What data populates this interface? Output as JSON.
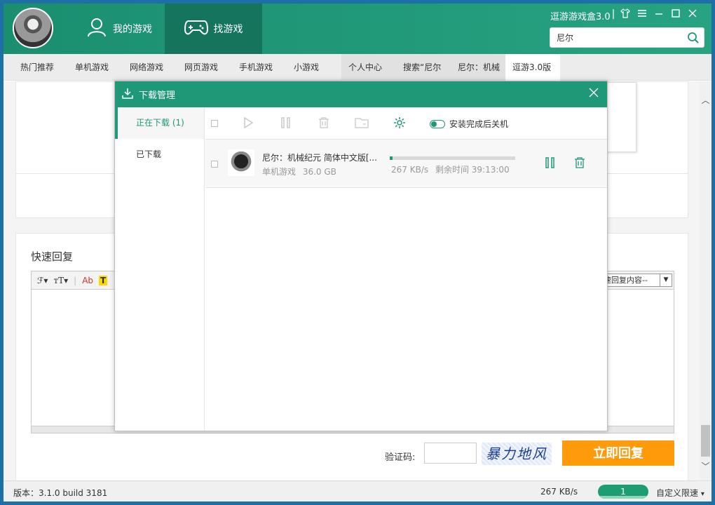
{
  "header": {
    "tabs": [
      {
        "label": "我的游戏",
        "icon": "user-icon"
      },
      {
        "label": "找游戏",
        "icon": "gamepad-icon"
      }
    ],
    "brand": "逗游游戏盒3.0",
    "window_controls": [
      "shirt-icon",
      "menu-icon",
      "minimize-icon",
      "maximize-icon",
      "close-icon"
    ],
    "search": {
      "value": "尼尔",
      "icon": "search-icon"
    }
  },
  "categories": [
    "热门推荐",
    "单机游戏",
    "网络游戏",
    "网页游戏",
    "手机游戏",
    "小游戏",
    "个人中心",
    "搜索“尼尔",
    "尼尔：机械",
    "逗游3.0版"
  ],
  "reply": {
    "title": "快速回复",
    "toolbar": [
      "ℱ▾",
      "ᴛT▾",
      "Ab",
      "T"
    ],
    "quick_select": "速回复内容--",
    "captcha_label": "验证码:",
    "captcha_text": "暴力地风",
    "submit": "立即回复"
  },
  "status": {
    "version": "版本：3.1.0 build 3181",
    "speed": "267 KB/s",
    "count": "1",
    "limit": "自定义限速"
  },
  "download_manager": {
    "title": "下载管理",
    "side": [
      "正在下载 (1)",
      "已下载"
    ],
    "tools": [
      "checkbox-icon",
      "play-icon",
      "pause-icon",
      "delete-icon",
      "folder-icon",
      "settings-icon"
    ],
    "shutdown_option": "安装完成后关机",
    "items": [
      {
        "name": "尼尔：机械纪元  简体中文版[...",
        "category": "单机游戏",
        "size": "36.0 GB",
        "speed": "267 KB/s",
        "remaining": "剩余时间 39:13:00",
        "progress": 0.02
      }
    ]
  },
  "colors": {
    "accent": "#1e9877",
    "header": "#27a382",
    "button": "#ff9a0a"
  }
}
